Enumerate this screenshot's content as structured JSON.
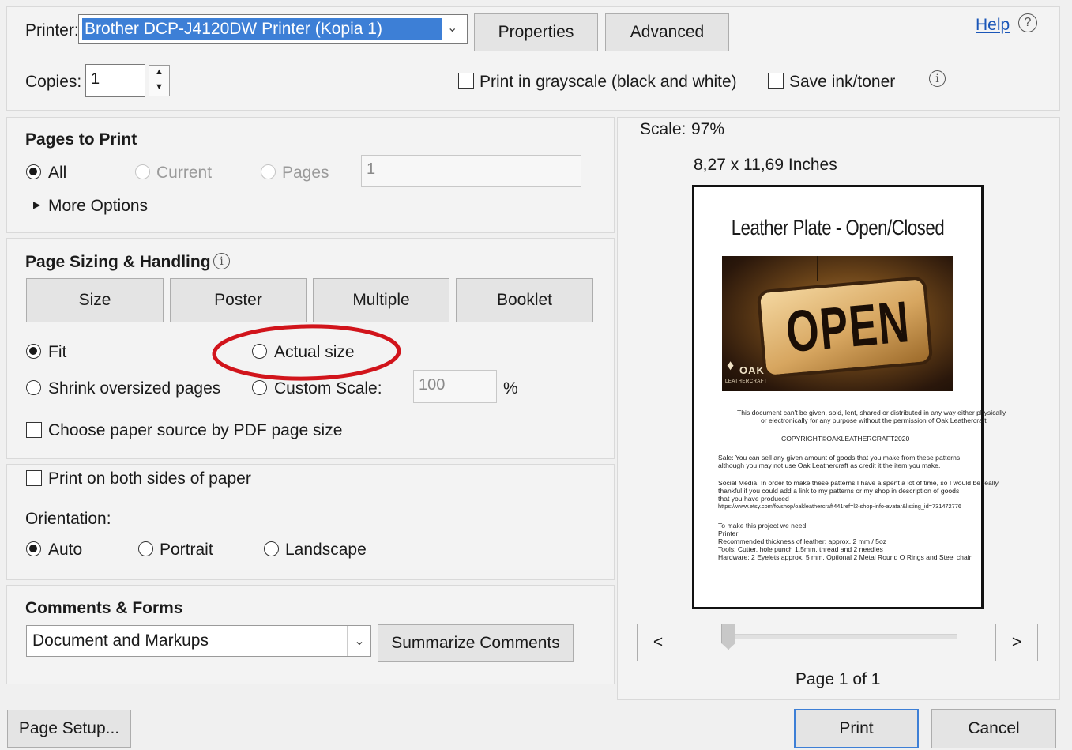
{
  "top": {
    "printer_label": "Printer:",
    "printer_value": "Brother DCP-J4120DW Printer (Kopia 1)",
    "properties_label": "Properties",
    "advanced_label": "Advanced",
    "help_label": "Help",
    "copies_label": "Copies:",
    "copies_value": "1",
    "grayscale_label": "Print in grayscale (black and white)",
    "save_ink_label": "Save ink/toner"
  },
  "pages_to_print": {
    "title": "Pages to Print",
    "all_label": "All",
    "current_label": "Current",
    "pages_label": "Pages",
    "pages_value": "1",
    "more_options_label": "More Options"
  },
  "sizing": {
    "title": "Page Sizing & Handling",
    "tabs": [
      "Size",
      "Poster",
      "Multiple",
      "Booklet"
    ],
    "fit_label": "Fit",
    "actual_size_label": "Actual size",
    "shrink_label": "Shrink oversized pages",
    "custom_scale_label": "Custom Scale:",
    "custom_scale_value": "100",
    "percent_label": "%",
    "paper_source_label": "Choose paper source by PDF page size"
  },
  "duplex": {
    "both_sides_label": "Print on both sides of paper",
    "orientation_label": "Orientation:",
    "auto_label": "Auto",
    "portrait_label": "Portrait",
    "landscape_label": "Landscape"
  },
  "comments": {
    "title": "Comments & Forms",
    "select_value": "Document and Markups",
    "summarize_label": "Summarize Comments"
  },
  "preview": {
    "scale_label": "Scale:",
    "scale_value": "97%",
    "dimensions": "8,27 x 11,69 Inches",
    "doc_title": "Leather Plate - Open/Closed",
    "sign_text": "OPEN",
    "brand_text": "OAK",
    "brand_sub": "LEATHERCRAFT",
    "body_lines": [
      "This document can't be given, sold, lent, shared or distributed in any way either physically",
      "or electronically for any purpose without the permission of Oak Leathercraft",
      "",
      "COPYRIGHT©OAKLEATHERCRAFT2020",
      "",
      "Sale: You can sell any given amount of goods that you make from these patterns,",
      "although you may not use Oak Leathercraft as credit it the item you make.",
      "",
      "Social Media: In order to make these patterns I have a spent a lot of time, so I would be really",
      "thankful if you could add a link to my patterns or my shop in description of goods",
      "that you have produced",
      "https://www.etsy.com/fo/shop/oakleathercraft441ref=l2-shop-info-avatar&listing_id=731472776",
      "",
      "To make this project we need:",
      "Printer",
      "Recommended thickness of leather: approx. 2 mm / 5oz",
      "Tools: Cutter, hole punch 1.5mm, thread and 2 needles",
      "Hardware: 2 Eyelets approx. 5 mm. Optional 2 Metal Round O Rings and Steel chain"
    ],
    "prev_label": "<",
    "next_label": ">",
    "page_indicator": "Page 1 of 1"
  },
  "footer": {
    "page_setup_label": "Page Setup...",
    "print_label": "Print",
    "cancel_label": "Cancel"
  }
}
